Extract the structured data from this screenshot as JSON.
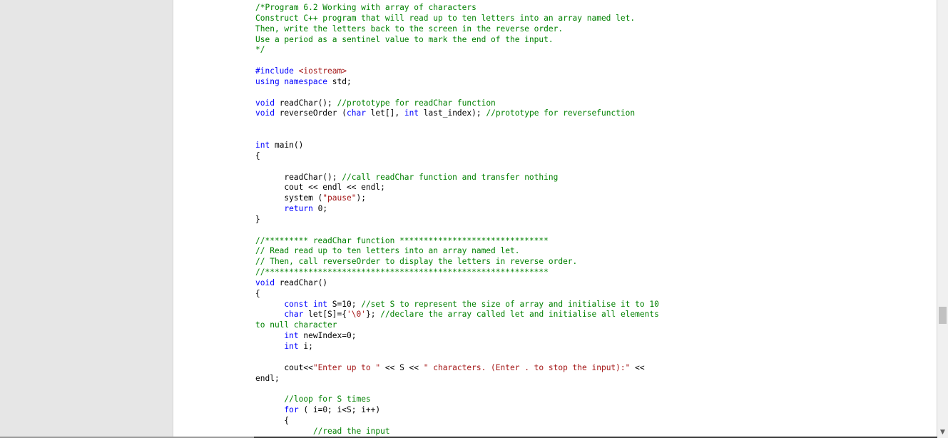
{
  "document": {
    "lines": [
      [
        {
          "t": "/*Program 6.2 Working with array of characters",
          "c": "c"
        }
      ],
      [
        {
          "t": "Construct C++ program that will read up to ten letters into an array named let.",
          "c": "c"
        }
      ],
      [
        {
          "t": "Then, write the letters back to the screen in the reverse order.",
          "c": "c"
        }
      ],
      [
        {
          "t": "Use a period as a sentinel value to mark the end of the input.",
          "c": "c"
        }
      ],
      [
        {
          "t": "*/",
          "c": "c"
        }
      ],
      [],
      [
        {
          "t": "#include ",
          "c": "k"
        },
        {
          "t": "<iostream>",
          "c": "s"
        }
      ],
      [
        {
          "t": "using namespace ",
          "c": "k"
        },
        {
          "t": "std;",
          "c": "t"
        }
      ],
      [],
      [
        {
          "t": "void ",
          "c": "k"
        },
        {
          "t": "readChar(); ",
          "c": "t"
        },
        {
          "t": "//prototype for readChar function",
          "c": "c"
        }
      ],
      [
        {
          "t": "void ",
          "c": "k"
        },
        {
          "t": "reverseOrder (",
          "c": "t"
        },
        {
          "t": "char ",
          "c": "k"
        },
        {
          "t": "let[], ",
          "c": "t"
        },
        {
          "t": "int ",
          "c": "k"
        },
        {
          "t": "last_index); ",
          "c": "t"
        },
        {
          "t": "//prototype for reversefunction",
          "c": "c"
        }
      ],
      [],
      [],
      [
        {
          "t": "int ",
          "c": "k"
        },
        {
          "t": "main()",
          "c": "t"
        }
      ],
      [
        {
          "t": "{",
          "c": "t"
        }
      ],
      [],
      [
        {
          "t": "      readChar(); ",
          "c": "t"
        },
        {
          "t": "//call readChar function and transfer nothing",
          "c": "c"
        }
      ],
      [
        {
          "t": "      cout << endl << endl;",
          "c": "t"
        }
      ],
      [
        {
          "t": "      system (",
          "c": "t"
        },
        {
          "t": "\"pause\"",
          "c": "s"
        },
        {
          "t": ");",
          "c": "t"
        }
      ],
      [
        {
          "t": "      ",
          "c": "t"
        },
        {
          "t": "return ",
          "c": "k"
        },
        {
          "t": "0;",
          "c": "t"
        }
      ],
      [
        {
          "t": "}",
          "c": "t"
        }
      ],
      [],
      [
        {
          "t": "//********* readChar function *******************************",
          "c": "c"
        }
      ],
      [
        {
          "t": "// Read read up to ten letters into an array named let.",
          "c": "c"
        }
      ],
      [
        {
          "t": "// Then, call reverseOrder to display the letters in reverse order.",
          "c": "c"
        }
      ],
      [
        {
          "t": "//***********************************************************",
          "c": "c"
        }
      ],
      [
        {
          "t": "void ",
          "c": "k"
        },
        {
          "t": "readChar()",
          "c": "t"
        }
      ],
      [
        {
          "t": "{",
          "c": "t"
        }
      ],
      [
        {
          "t": "      ",
          "c": "t"
        },
        {
          "t": "const int ",
          "c": "k"
        },
        {
          "t": "S=10; ",
          "c": "t"
        },
        {
          "t": "//set S to represent the size of array and initialise it to 10",
          "c": "c"
        }
      ],
      [
        {
          "t": "      ",
          "c": "t"
        },
        {
          "t": "char ",
          "c": "k"
        },
        {
          "t": "let[S]={",
          "c": "t"
        },
        {
          "t": "'\\0'",
          "c": "s"
        },
        {
          "t": "}; ",
          "c": "t"
        },
        {
          "t": "//declare the array called let and initialise all elements",
          "c": "c"
        }
      ],
      [
        {
          "t": "to null character",
          "c": "c"
        }
      ],
      [
        {
          "t": "      ",
          "c": "t"
        },
        {
          "t": "int ",
          "c": "k"
        },
        {
          "t": "newIndex=0;",
          "c": "t"
        }
      ],
      [
        {
          "t": "      ",
          "c": "t"
        },
        {
          "t": "int ",
          "c": "k"
        },
        {
          "t": "i;",
          "c": "t"
        }
      ],
      [],
      [
        {
          "t": "      cout<<",
          "c": "t"
        },
        {
          "t": "\"Enter up to \"",
          "c": "s"
        },
        {
          "t": " << S << ",
          "c": "t"
        },
        {
          "t": "\" characters. (Enter . to stop the input):\"",
          "c": "s"
        },
        {
          "t": " <<",
          "c": "t"
        }
      ],
      [
        {
          "t": "endl;",
          "c": "t"
        }
      ],
      [],
      [
        {
          "t": "      ",
          "c": "t"
        },
        {
          "t": "//loop for S times",
          "c": "c"
        }
      ],
      [
        {
          "t": "      ",
          "c": "t"
        },
        {
          "t": "for ",
          "c": "k"
        },
        {
          "t": "( i=0; i<S; i++)",
          "c": "t"
        }
      ],
      [
        {
          "t": "      {",
          "c": "t"
        }
      ],
      [
        {
          "t": "            ",
          "c": "t"
        },
        {
          "t": "//read the input",
          "c": "c"
        }
      ]
    ]
  },
  "scrollbar": {
    "down_arrow_icon": "▼"
  }
}
